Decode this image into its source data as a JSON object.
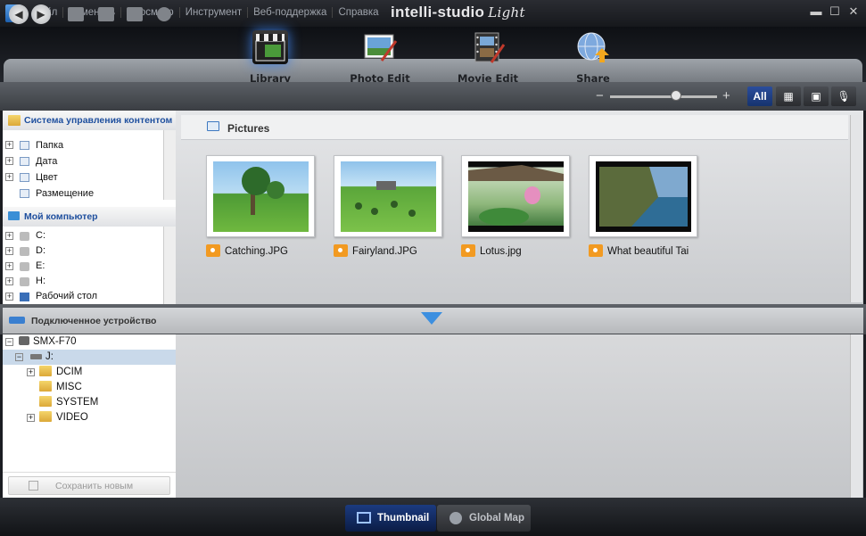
{
  "menu": [
    "Файл",
    "Изменить",
    "Просмотр",
    "Инструмент",
    "Веб-поддержка",
    "Справка"
  ],
  "brand": {
    "main": "intelli-studio",
    "sub": "Light"
  },
  "modes": [
    {
      "label": "Library",
      "icon": "clapperboard-icon"
    },
    {
      "label": "Photo Edit",
      "icon": "photo-edit-icon"
    },
    {
      "label": "Movie Edit",
      "icon": "film-edit-icon"
    },
    {
      "label": "Share",
      "icon": "globe-share-icon"
    }
  ],
  "zoom": {
    "minus": "−",
    "plus": "+",
    "level_fraction": 0.62
  },
  "filters": {
    "all": "All"
  },
  "sidebar": {
    "cms_title": "Система управления контентом",
    "cms_items": [
      "Папка",
      "Дата",
      "Цвет",
      "Размещение"
    ],
    "pc_title": "Мой компьютер",
    "pc_items": [
      "C:",
      "D:",
      "E:",
      "H:",
      "Рабочий стол"
    ]
  },
  "main": {
    "folder": "Pictures",
    "photos": [
      {
        "caption": "Catching.JPG"
      },
      {
        "caption": "Fairyland.JPG"
      },
      {
        "caption": "Lotus.jpg"
      },
      {
        "caption": "What beautiful Tai"
      }
    ]
  },
  "device": {
    "title": "Подключенное устройство",
    "camera": "SMX-F70",
    "drive": "J:",
    "folders": [
      "DCIM",
      "MISC",
      "SYSTEM",
      "VIDEO"
    ],
    "save_label": "Сохранить новым"
  },
  "bottom_tabs": {
    "thumbnail": "Thumbnail",
    "globalmap": "Global Map"
  },
  "colors": {
    "accent": "#1e4f9e",
    "folder": "#e8b94a",
    "photo_badge": "#f29a21"
  }
}
